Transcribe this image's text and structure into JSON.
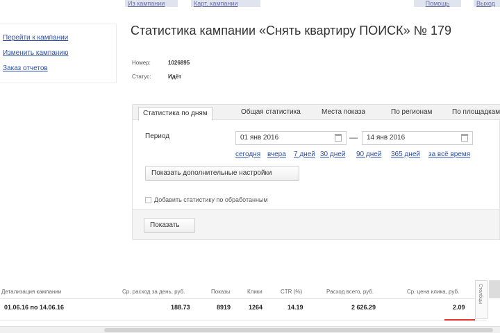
{
  "top_tabs": [
    "Из кампании",
    "Карт. кампании",
    "Помощь",
    "Выход"
  ],
  "sidebar": {
    "links": [
      "Перейти к кампании",
      "Изменить кампанию",
      "Заказ отчетов"
    ]
  },
  "header": {
    "title": "Статистика кампании «Снять квартиру ПОИСК» № 179",
    "meta": [
      {
        "label": "Номер:",
        "value": "1026895"
      },
      {
        "label": "Статус:",
        "value": "Идёт"
      }
    ]
  },
  "panel": {
    "tabs": [
      {
        "label": "Статистика по дням",
        "active": true
      },
      {
        "label": "Общая статистика",
        "active": false
      },
      {
        "label": "Места показа",
        "active": false
      },
      {
        "label": "По регионам",
        "active": false
      },
      {
        "label": "По площадкам",
        "active": false
      }
    ],
    "period_label": "Период",
    "date_from": "01 янв 2016",
    "date_to": "14 янв 2016",
    "quick_ranges": [
      "сегодня",
      "вчера",
      "7 дней",
      "30 дней",
      "90 дней",
      "365 дней",
      "за всё время"
    ],
    "more_settings_button": "Показать дополнительные настройки",
    "checkbox_label": "Добавить статистику по обработанным",
    "show_button": "Показать"
  },
  "table": {
    "columns": [
      "Детализация кампании",
      "Ср. расход за день, руб.",
      "Показы",
      "Клики",
      "CTR (%)",
      "Расход всего, руб.",
      "Ср. цена клика, руб."
    ],
    "row": [
      "01.06.16 по 14.06.16",
      "188.73",
      "8919",
      "1264",
      "14.19",
      "2 626.29",
      "2.09"
    ]
  },
  "column_control_label": "Столбцы"
}
